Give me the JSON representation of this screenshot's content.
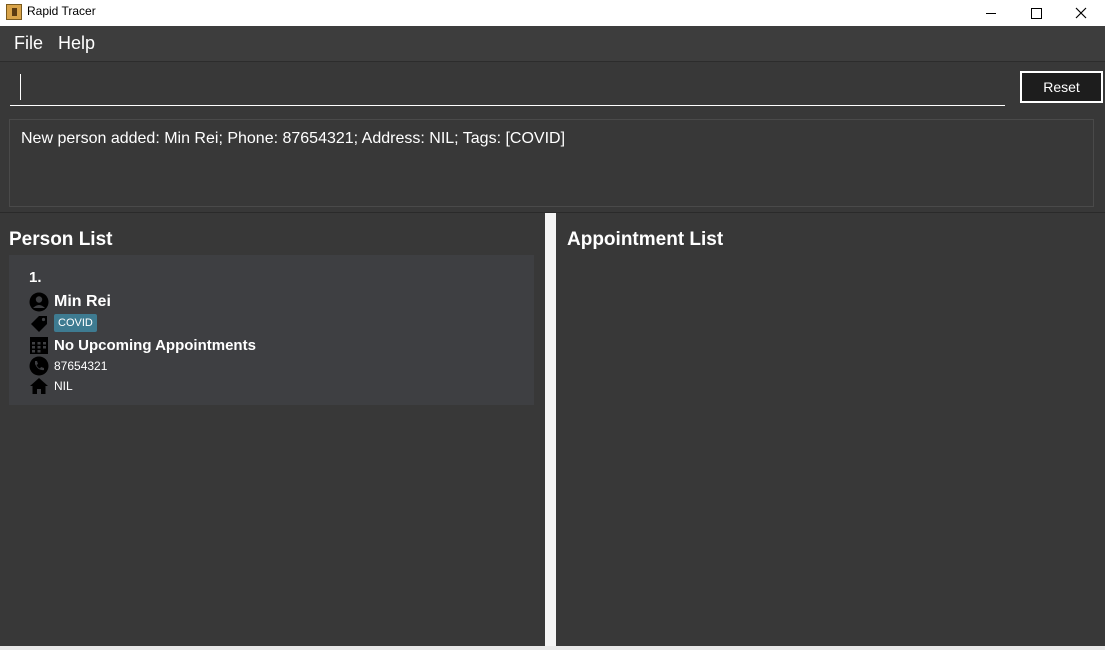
{
  "window": {
    "title": "Rapid Tracer"
  },
  "menu": {
    "file_label": "File",
    "help_label": "Help"
  },
  "command": {
    "value": "",
    "reset_label": "Reset"
  },
  "result": {
    "message": "New person added: Min Rei; Phone: 87654321; Address: NIL; Tags: [COVID]"
  },
  "person_list": {
    "title": "Person List",
    "persons": [
      {
        "index": "1.",
        "name": "Min Rei",
        "tags": [
          "COVID"
        ],
        "appointments": "No Upcoming Appointments",
        "phone": "87654321",
        "address": "NIL"
      }
    ]
  },
  "appointment_list": {
    "title": "Appointment List"
  },
  "icons": {
    "person": "person-icon",
    "tag": "tag-icon",
    "calendar": "calendar-icon",
    "phone": "phone-icon",
    "home": "home-icon"
  },
  "colors": {
    "tag_bg": "#3e7b91",
    "background": "#383838"
  }
}
